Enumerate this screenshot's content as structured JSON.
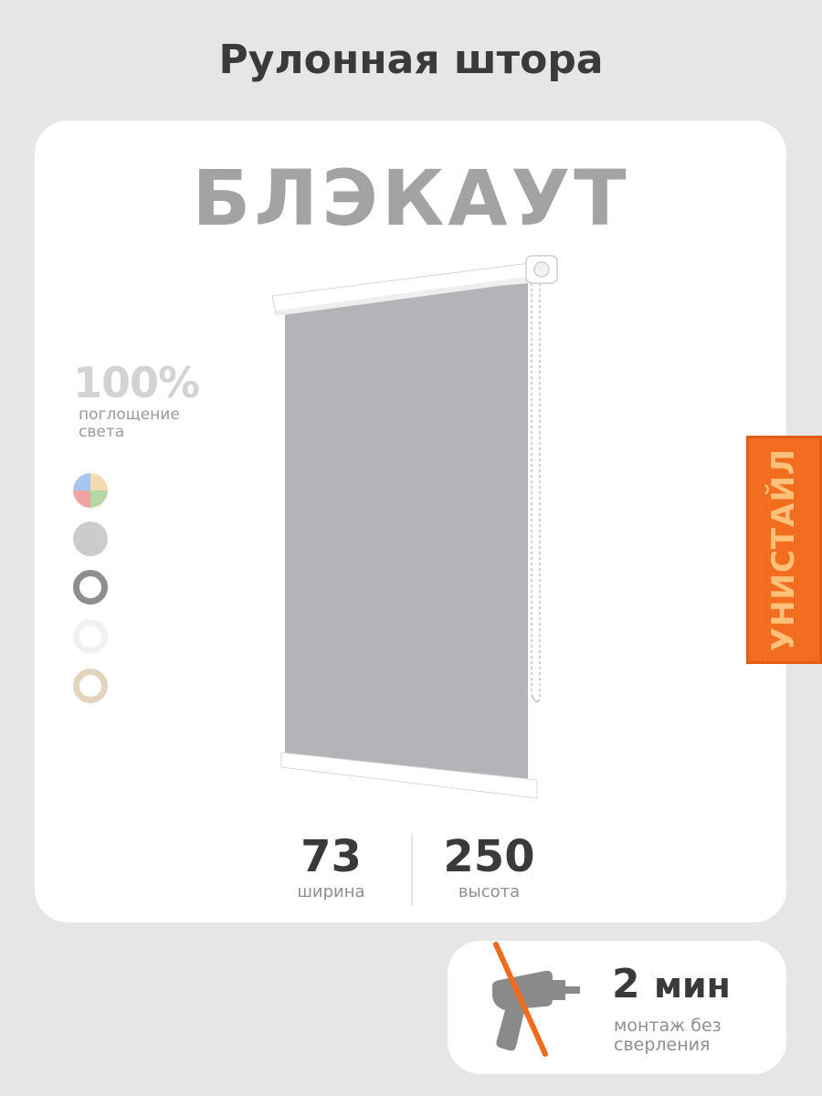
{
  "header": {
    "title": "Рулонная штора"
  },
  "product": {
    "type": "БЛЭКАУТ"
  },
  "light": {
    "value": "100%",
    "label": "поглощение света"
  },
  "color_swatches": [
    {
      "name": "multicolor"
    },
    {
      "name": "grey",
      "color": "#cccccc"
    },
    {
      "name": "dark-grey-ring",
      "color": "#8e8e8e"
    },
    {
      "name": "white-ring",
      "color": "#f1f1f1"
    },
    {
      "name": "beige-ring",
      "color": "#e3d4bf"
    }
  ],
  "dimensions": {
    "width_value": "73",
    "width_label": "ширина",
    "height_value": "250",
    "height_label": "высота"
  },
  "brand": {
    "name": "УНИСТАЙЛ",
    "color": "#f26a1b"
  },
  "install": {
    "time_value": "2",
    "time_unit": "мин",
    "label": "монтаж без сверления"
  },
  "colors": {
    "blind_fabric": "#b3b4b8",
    "accent": "#f26a1b",
    "text_dark": "#3a3a3a"
  }
}
